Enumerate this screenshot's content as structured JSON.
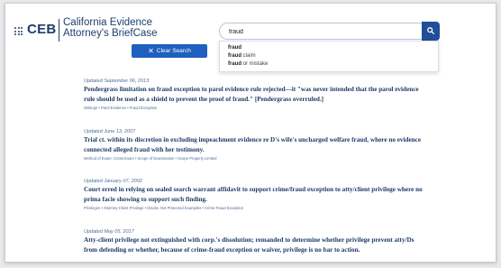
{
  "header": {
    "logo_short": "CEB",
    "logo_line1": "California Evidence",
    "logo_line2": "Attorney's BriefCase",
    "clear_label": "Clear Search"
  },
  "search": {
    "value": "fraud",
    "placeholder": ""
  },
  "suggestions": [
    {
      "bold": "fraud",
      "rest": ""
    },
    {
      "bold": "fraud",
      "rest": " claim"
    },
    {
      "bold": "fraud",
      "rest": " or mistake"
    }
  ],
  "results": [
    {
      "updated": "Updated September 06, 2013",
      "title": "Pendergrass limitation on fraud exception to parol evidence rule rejected—it \"was never intended that the parol evidence rule should be used as a shield to prevent the proof of fraud.\" [Pendergrass overruled.]",
      "tags": "Writings • Parol Evidence • Fraud Exception"
    },
    {
      "updated": "Updated June 13, 2007",
      "title": "Trial ct. within its discretion in excluding impeachment evidence re D's wife's uncharged welfare fraud, where no evidence connected alleged fraud with her testimony.",
      "tags": "Method of Exam: Cross-Exam • Scope of Examination • Scope Properly Limited"
    },
    {
      "updated": "Updated January 07, 2002",
      "title": "Court erred in relying on sealed search warrant affidavit to support crime/fraud exception to atty/client privilege where no prima facie showing to support such finding.",
      "tags": "Privileges • Attorney-Client Privilege • Discks. Not Protected Examples • Crime-Fraud Exception"
    },
    {
      "updated": "Updated May 05, 2017",
      "title": "Atty-client privilege not extinguished with corp.'s dissolution; remanded to determine whether privilege prevent atty/Ds from defending or whether, because of crime-fraud exception or waiver, privilege is no bar to action.",
      "tags": ""
    }
  ]
}
